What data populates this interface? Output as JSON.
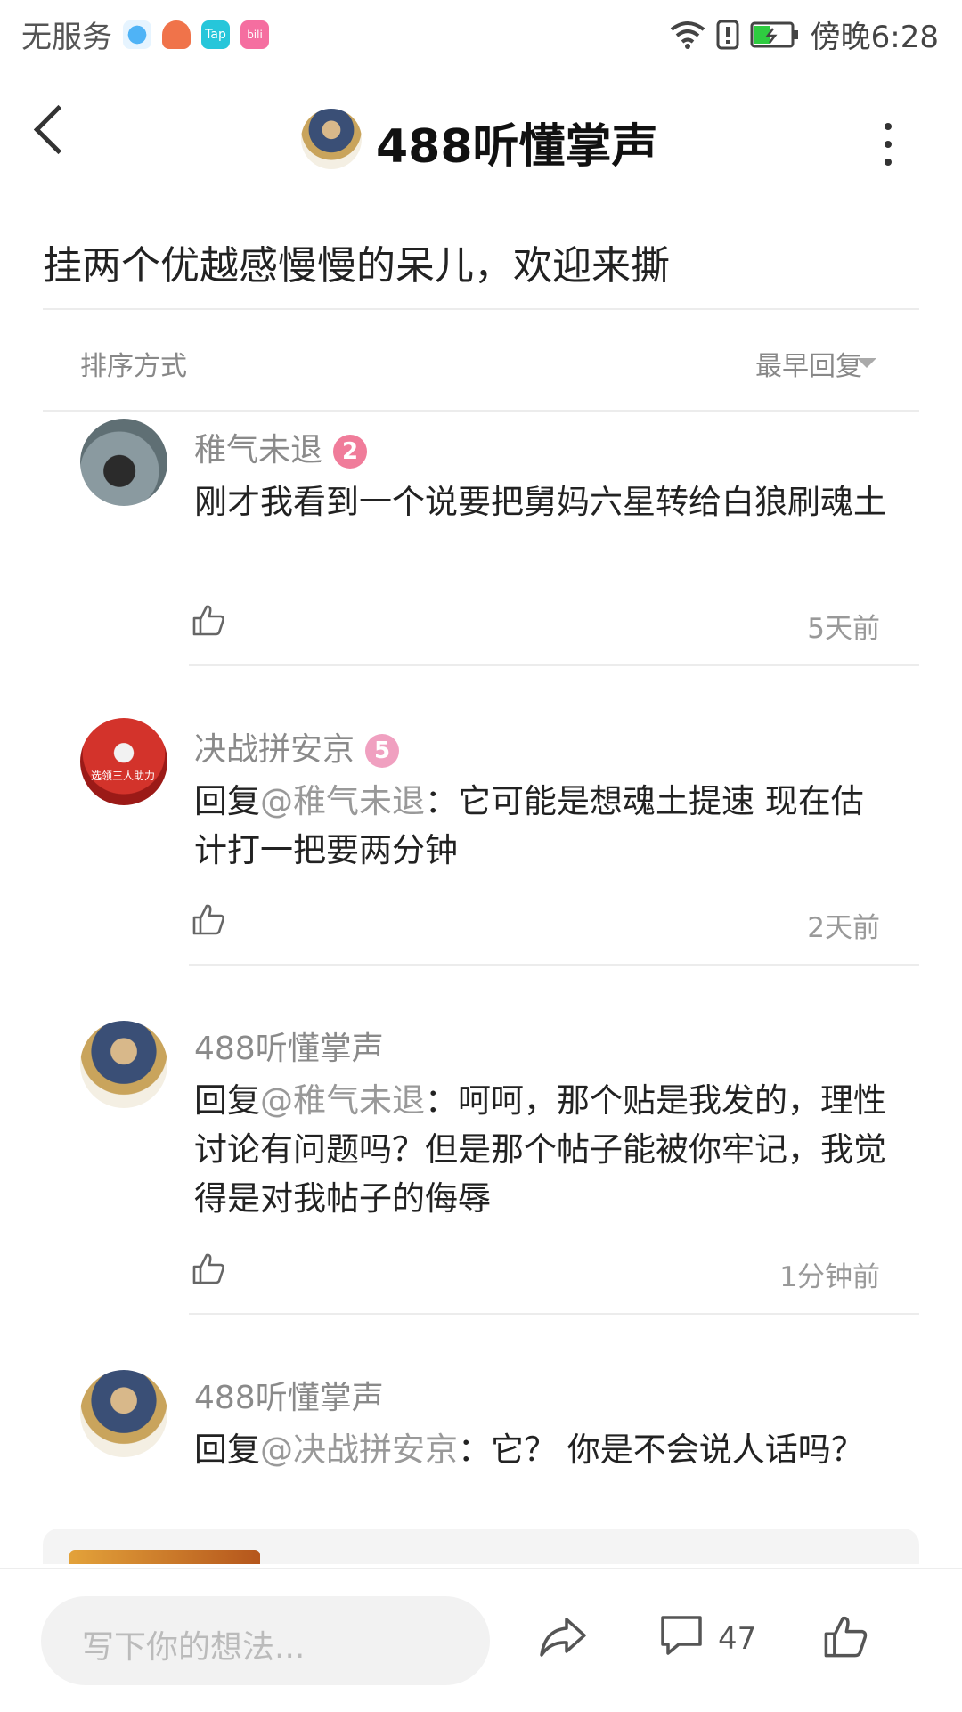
{
  "status_bar": {
    "carrier": "无服务",
    "time": "傍晚6:28",
    "apps": [
      "q-icon",
      "orange-app-icon",
      "taptap-icon",
      "bilibili-icon"
    ],
    "app_labels": {
      "tap": "Tap",
      "bili": "bili"
    }
  },
  "header": {
    "title": "488听懂掌声"
  },
  "post": {
    "title": "挂两个优越感慢慢的呆儿，欢迎来撕"
  },
  "sort": {
    "label": "排序方式",
    "value": "最早回复"
  },
  "comments": [
    {
      "author": "稚气未退",
      "level": "2",
      "level_color": "#f07c9a",
      "text": "刚才我看到一个说要把舅妈六星转给白狼刷魂土",
      "time": "5天前"
    },
    {
      "author": "决战拼安京",
      "level": "5",
      "level_color": "#f0a0c0",
      "reply_prefix": "回复",
      "reply_to": "@稚气未退",
      "text": "：它可能是想魂土提速 现在估计打一把要两分钟",
      "avatar_text": "选领三人助力",
      "time": "2天前"
    },
    {
      "author": "488听懂掌声",
      "reply_prefix": "回复",
      "reply_to": "@稚气未退",
      "text": "：呵呵，那个贴是我发的，理性讨论有问题吗？但是那个帖子能被你牢记，我觉得是对我帖子的侮辱",
      "time": "1分钟前"
    },
    {
      "author": "488听懂掌声",
      "reply_prefix": "回复",
      "reply_to": "@决战拼安京",
      "text": "：它？ 你是不会说人话吗？"
    }
  ],
  "bottom_bar": {
    "input_placeholder": "写下你的想法...",
    "comment_count": "47"
  },
  "colors": {
    "level2": "#f07c9a",
    "level5": "#f0a0c0"
  }
}
